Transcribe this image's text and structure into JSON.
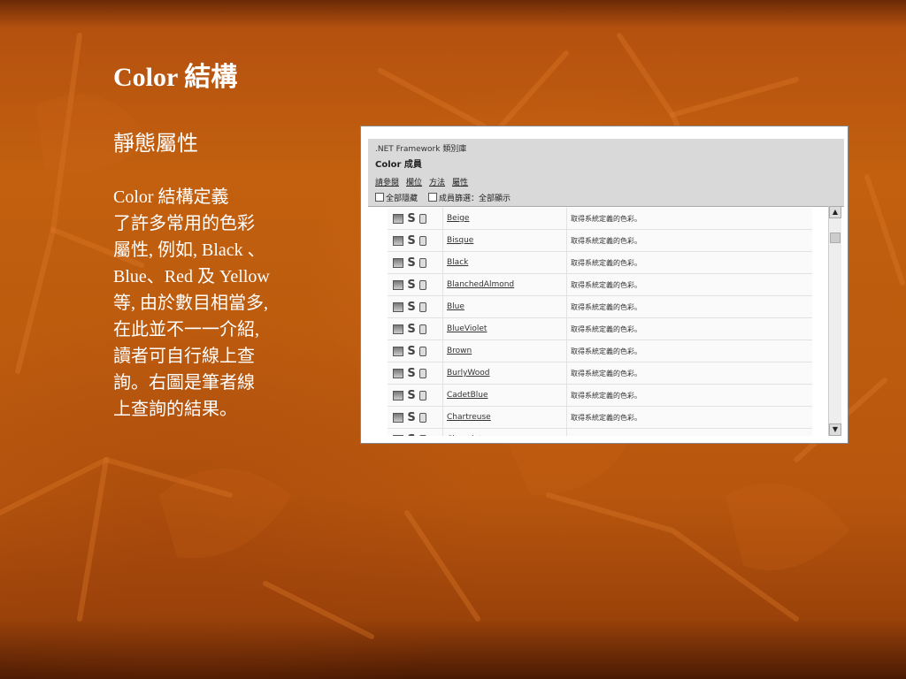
{
  "slide": {
    "title": "Color 結構",
    "subtitle": "靜態屬性",
    "body_lines": [
      "Color 結構定義",
      "了許多常用的色彩",
      "屬性, 例如, Black 、",
      "Blue、Red 及 Yellow",
      "等, 由於數目相當多,",
      "在此並不一一介紹,",
      "讀者可自行線上查",
      "詢。右圖是筆者線",
      "上查詢的結果。"
    ]
  },
  "screenshot": {
    "framework_label": ".NET Framework 類別庫",
    "class_title": "Color 成員",
    "links": [
      "請參閱",
      "欄位",
      "方法",
      "屬性"
    ],
    "filter_1": "全部隱藏",
    "filter_2": "成員篩選：全部顯示",
    "rows": [
      {
        "name": "Beige",
        "desc": "取得系統定義的色彩。"
      },
      {
        "name": "Bisque",
        "desc": "取得系統定義的色彩。"
      },
      {
        "name": "Black",
        "desc": "取得系統定義的色彩。"
      },
      {
        "name": "BlanchedAlmond",
        "desc": "取得系統定義的色彩。"
      },
      {
        "name": "Blue",
        "desc": "取得系統定義的色彩。"
      },
      {
        "name": "BlueViolet",
        "desc": "取得系統定義的色彩。"
      },
      {
        "name": "Brown",
        "desc": "取得系統定義的色彩。"
      },
      {
        "name": "BurlyWood",
        "desc": "取得系統定義的色彩。"
      },
      {
        "name": "CadetBlue",
        "desc": "取得系統定義的色彩。"
      },
      {
        "name": "Chartreuse",
        "desc": "取得系統定義的色彩。"
      },
      {
        "name": "Chocolate",
        "desc": "取得系統定義的色彩。"
      }
    ]
  },
  "colors": {
    "background": "#b8560e",
    "text": "#ffffff"
  }
}
